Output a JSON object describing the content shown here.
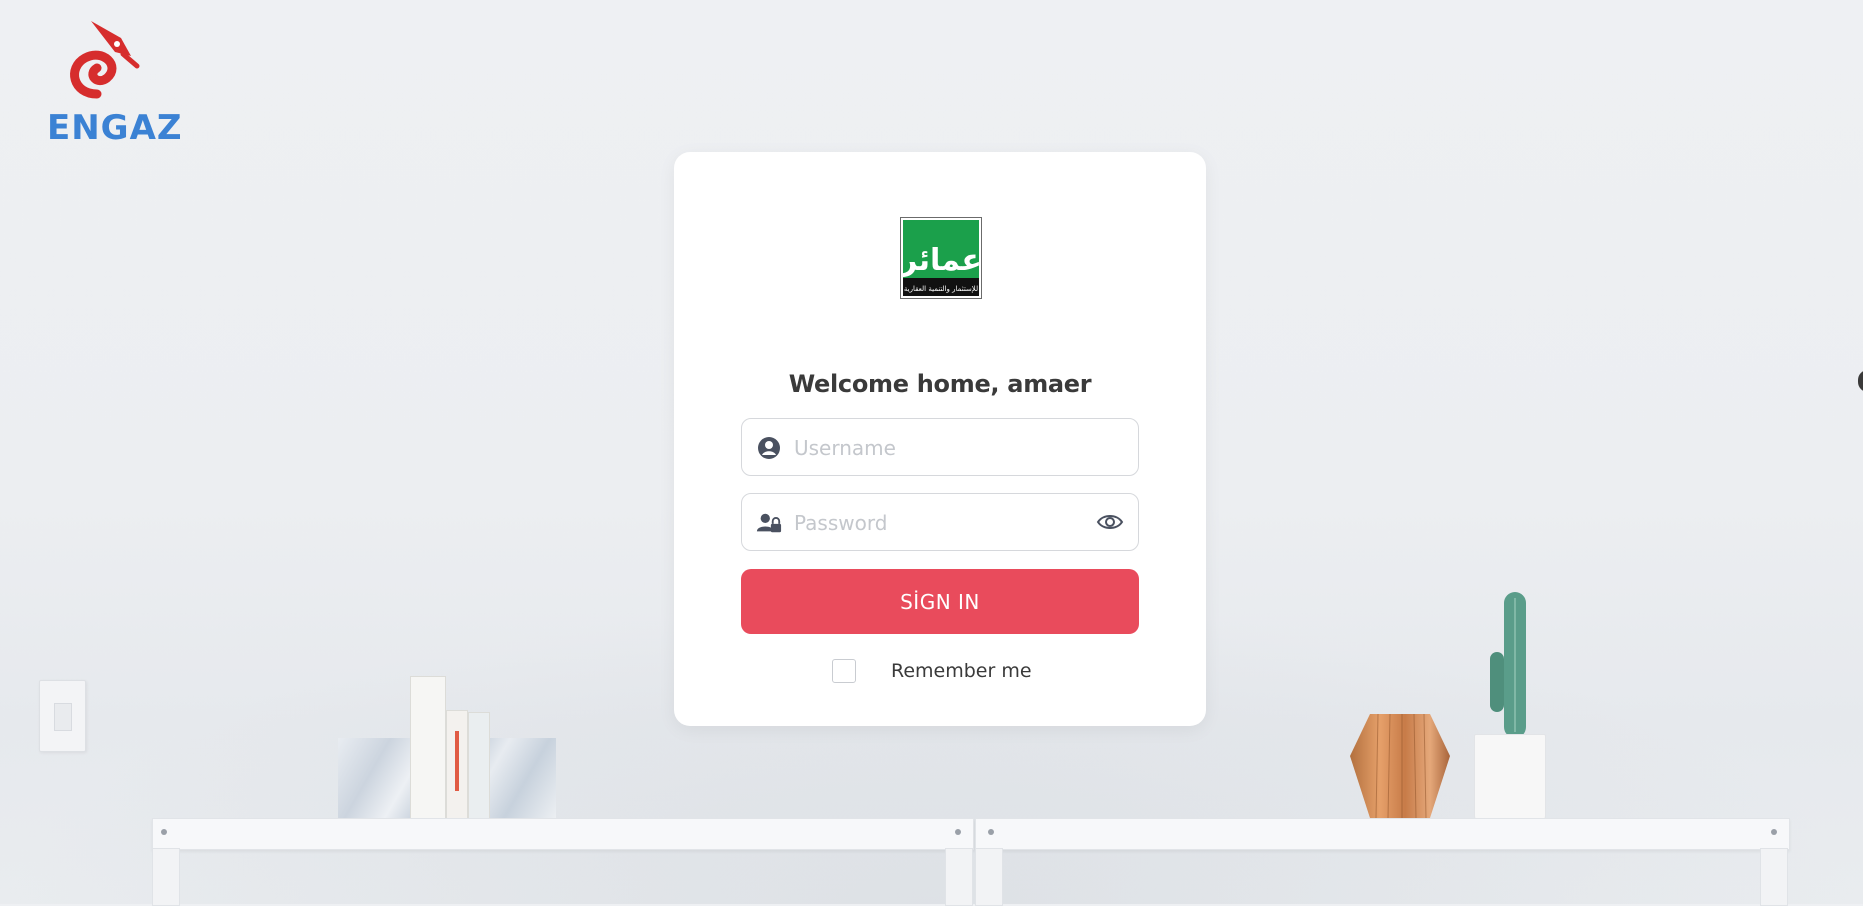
{
  "brand": {
    "name": "ENGAZ",
    "accent": "#3b82d4",
    "icon_color": "#d62d2d"
  },
  "client_logo": {
    "text": "عمائر",
    "subtext": "للإستثمار والتنمية العقارية",
    "color": "#1ba04b"
  },
  "login": {
    "welcome": "Welcome home, amaer",
    "username_placeholder": "Username",
    "password_placeholder": "Password",
    "signin_label": "SİGN IN",
    "remember_label": "Remember me",
    "button_color": "#e94b5c"
  },
  "icons": {
    "username": "user-circle-icon",
    "password": "user-lock-icon",
    "toggle_password": "eye-icon"
  }
}
